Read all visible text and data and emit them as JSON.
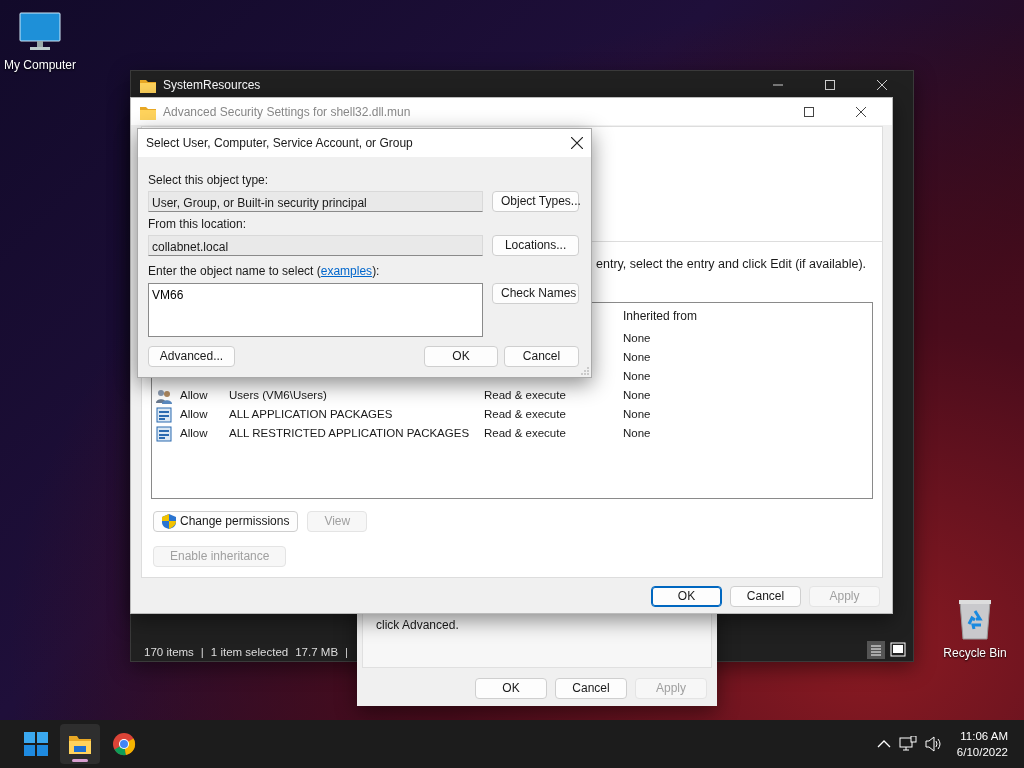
{
  "desktop_icons": [
    {
      "kind": "computer",
      "label": "My Computer"
    },
    {
      "kind": "recycle",
      "label": "Recycle Bin"
    }
  ],
  "explorer": {
    "title": "SystemResources",
    "status_bar": [
      "170 items",
      "|",
      "1 item selected",
      "17.7 MB",
      "|"
    ]
  },
  "properties_dialog": {
    "text": "click Advanced.",
    "buttons": [
      {
        "label": "OK",
        "disabled": false
      },
      {
        "label": "Cancel",
        "disabled": false
      },
      {
        "label": "Apply",
        "disabled": true
      }
    ]
  },
  "security_window": {
    "title": "Advanced Security Settings for shell32.dll.mun",
    "hint": "entry, select the entry and click Edit (if available).",
    "columns": [
      "Inherited from"
    ],
    "entries": [
      {
        "inherited": "None"
      },
      {
        "inherited": "None"
      },
      {
        "inherited": "None"
      },
      {
        "kind": "users",
        "type": "Allow",
        "principal": "Users (VM6\\Users)",
        "access": "Read & execute",
        "inherited": "None"
      },
      {
        "kind": "package",
        "type": "Allow",
        "principal": "ALL APPLICATION PACKAGES",
        "access": "Read & execute",
        "inherited": "None"
      },
      {
        "kind": "package",
        "type": "Allow",
        "principal": "ALL RESTRICTED APPLICATION PACKAGES",
        "access": "Read & execute",
        "inherited": "None"
      }
    ],
    "permission_buttons": [
      {
        "label": "Change permissions",
        "shield": true,
        "disabled": false
      },
      {
        "label": "View",
        "shield": false,
        "disabled": true
      },
      {
        "label": "Enable inheritance",
        "shield": false,
        "disabled": true
      }
    ],
    "buttons": [
      {
        "label": "OK",
        "disabled": false,
        "default": true
      },
      {
        "label": "Cancel",
        "disabled": false,
        "default": false
      },
      {
        "label": "Apply",
        "disabled": true,
        "default": false
      }
    ]
  },
  "select_dialog": {
    "title": "Select User, Computer, Service Account, or Group",
    "object_type_label": "Select this object type:",
    "object_type": "User, Group, or Built-in security principal",
    "object_type_button": "Object Types...",
    "location_label": "From this location:",
    "location": "collabnet.local",
    "location_button": "Locations...",
    "name_label": "Enter the object name to select (",
    "name_link": "examples",
    "name_label_end": "):",
    "name_value": "VM66",
    "check_button": "Check Names",
    "buttons": [
      {
        "label": "Advanced..."
      },
      {
        "label": "OK"
      },
      {
        "label": "Cancel"
      }
    ]
  },
  "taskbar": {
    "apps": [
      {
        "kind": "start",
        "active": false
      },
      {
        "kind": "explorer",
        "active": true
      },
      {
        "kind": "chrome",
        "active": false
      }
    ],
    "time": "11:06 AM",
    "date": "6/10/2022"
  }
}
